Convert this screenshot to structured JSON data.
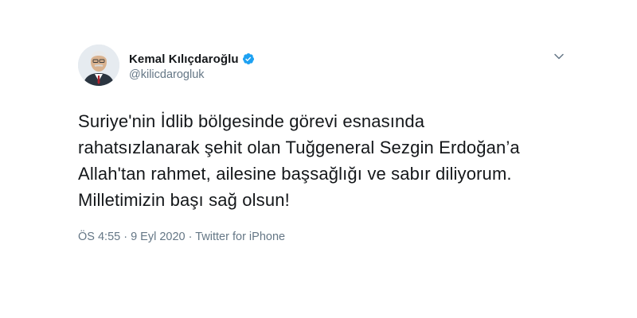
{
  "tweet": {
    "display_name": "Kemal Kılıçdaroğlu",
    "handle": "@kilicdarogluk",
    "verified_icon": "verified-badge-icon",
    "menu_icon": "chevron-down-icon",
    "accent_color": "#1da1f2",
    "text_lines": [
      "Suriye'nin İdlib bölgesinde görevi esnasında",
      "rahatsızlanarak şehit olan Tuğgeneral Sezgin Erdoğan’a",
      "Allah'tan rahmet, ailesine başsağlığı ve sabır diliyorum.",
      "Milletimizin başı sağ olsun!"
    ],
    "time": "ÖS 4:55",
    "separator_1": " · ",
    "date": "9 Eyl 2020",
    "separator_2": " · ",
    "source": "Twitter for iPhone"
  }
}
